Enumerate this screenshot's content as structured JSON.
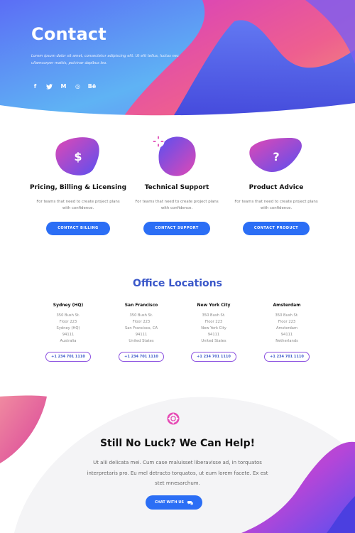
{
  "hero": {
    "title": "Contact",
    "text": "Lorem ipsum dolor sit amet, consectetur adipiscing elit. Ut elit tellus, luctus nec ullamcorper mattis, pulvinar dapibus leo.",
    "socials": [
      {
        "icon": "facebook-icon",
        "glyph": "f"
      },
      {
        "icon": "twitter-icon",
        "glyph": "t"
      },
      {
        "icon": "medium-icon",
        "glyph": "M"
      },
      {
        "icon": "dribbble-icon",
        "glyph": "◎"
      },
      {
        "icon": "behance-icon",
        "glyph": "Bē"
      }
    ]
  },
  "cards": [
    {
      "icon": "dollar-icon",
      "glyph": "$",
      "title": "Pricing, Billing & Licensing",
      "text": "For teams that need to create project plans with confidence.",
      "button": "CONTACT BILLING"
    },
    {
      "icon": "lifebuoy-icon",
      "glyph": "",
      "title": "Technical Support",
      "text": "For teams that need to create project plans with confidence.",
      "button": "CONTACT SUPPORT"
    },
    {
      "icon": "question-icon",
      "glyph": "?",
      "title": "Product Advice",
      "text": "For teams that need to create project plans with confidence.",
      "button": "CONTACT PRODUCT"
    }
  ],
  "offices": {
    "title": "Office Locations",
    "items": [
      {
        "city": "Sydney (HQ)",
        "lines": [
          "350 Bush St.",
          "Floor 223",
          "Sydney (HQ)",
          "94111",
          "Australia"
        ],
        "phone": "+1 234 701 1110"
      },
      {
        "city": "San Francisco",
        "lines": [
          "350 Bush St.",
          "Floor 223",
          "San Francisco, CA",
          "94111",
          "United States"
        ],
        "phone": "+1 234 701 1110"
      },
      {
        "city": "New York City",
        "lines": [
          "350 Bush St.",
          "Floor 223",
          "New York City",
          "94111",
          "United States"
        ],
        "phone": "+1 234 701 1110"
      },
      {
        "city": "Amsterdam",
        "lines": [
          "350 Bush St.",
          "Floor 223",
          "Amsterdam",
          "94111",
          "Netherlands"
        ],
        "phone": "+1 234 701 1110"
      }
    ]
  },
  "cta": {
    "title": "Still No Luck? We Can Help!",
    "text": "Ut alii delicata mei. Cum case maluisset liberavisse ad, in torquatos interpretaris pro. Eu mel detracto torquatos, ut eum lorem facete. Ex est stet mnesarchum.",
    "button": "CHAT WITH US",
    "button_icon": "chat-icon"
  },
  "colors": {
    "accent": "#2b6ef5",
    "heading_blue": "#3a57c9",
    "pink": "#e53fa8",
    "purple": "#7a4ff0"
  }
}
